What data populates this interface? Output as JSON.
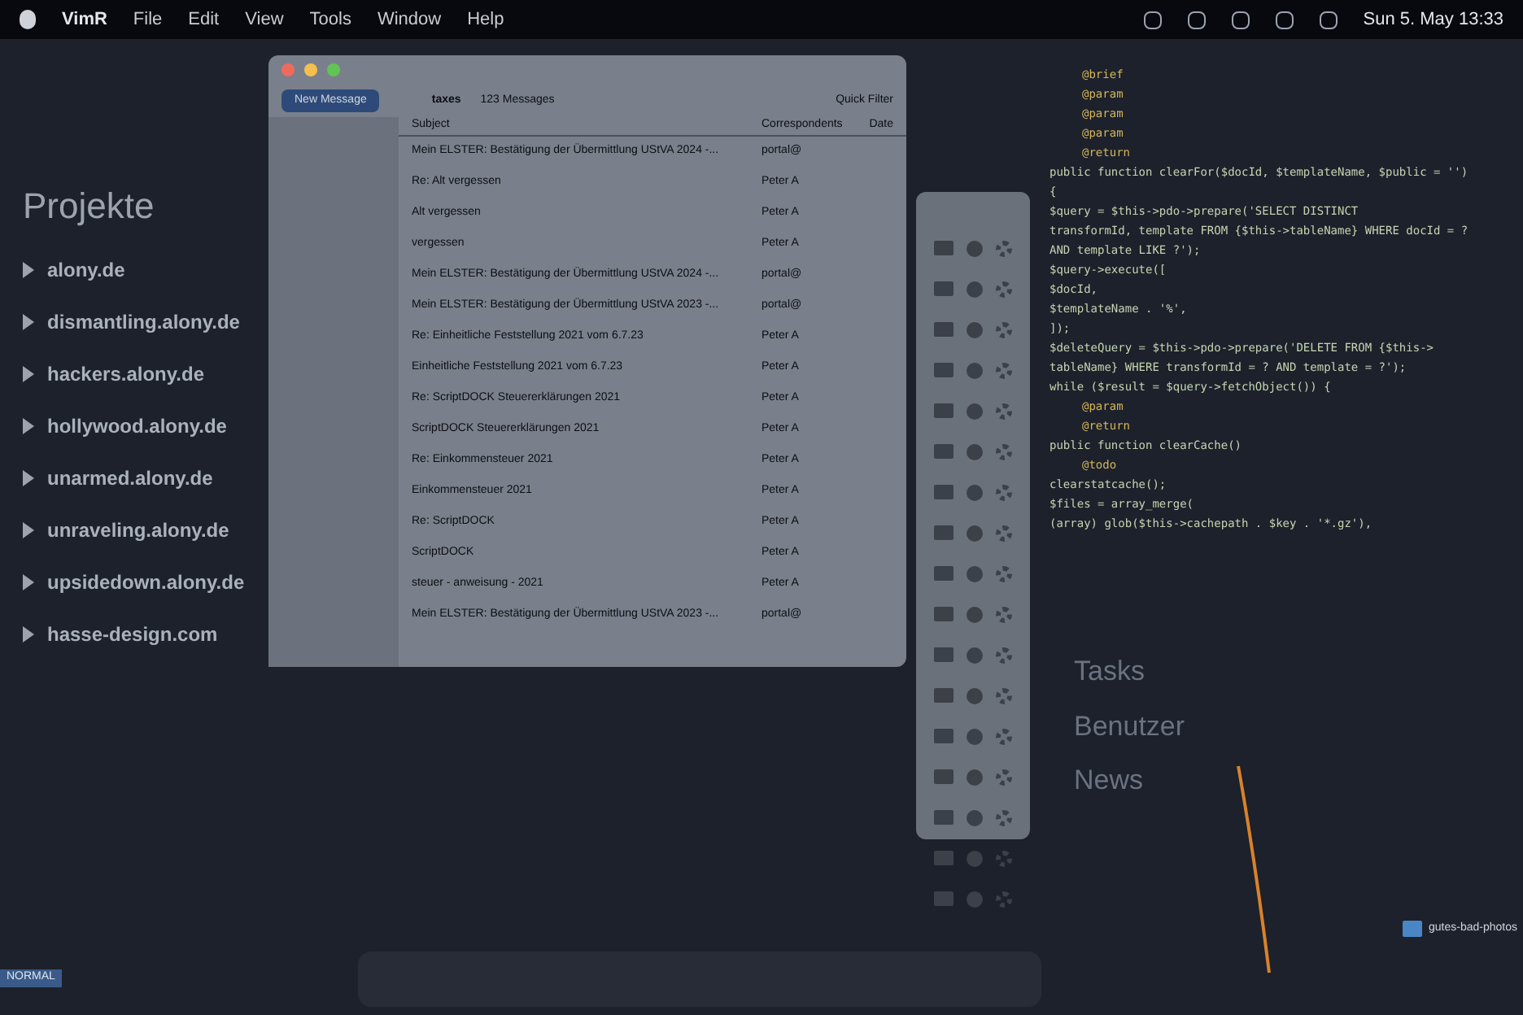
{
  "menu_bar": {
    "app": "VimR",
    "items": [
      "File",
      "Edit",
      "View",
      "Tools",
      "Window",
      "Help"
    ],
    "clock": "Sun 5. May 13:33"
  },
  "projects": {
    "title": "Projekte",
    "items": [
      "alony.de",
      "dismantling.alony.de",
      "hackers.alony.de",
      "hollywood.alony.de",
      "unarmed.alony.de",
      "unraveling.alony.de",
      "upsidedown.alony.de",
      "hasse-design.com"
    ]
  },
  "mail": {
    "new_message": "New Message",
    "folder": "taxes",
    "count": "123 Messages",
    "quick_filter": "Quick Filter",
    "columns": [
      "Subject",
      "Correspondents",
      "Date"
    ],
    "rows": [
      {
        "subject": "Mein ELSTER: Bestätigung der Übermittlung UStVA 2024 -...",
        "correspondent": "portal@"
      },
      {
        "subject": "Re: Alt vergessen",
        "correspondent": "Peter A"
      },
      {
        "subject": "Alt vergessen",
        "correspondent": "Peter A"
      },
      {
        "subject": "vergessen",
        "correspondent": "Peter A"
      },
      {
        "subject": "Mein ELSTER: Bestätigung der Übermittlung UStVA 2024 -...",
        "correspondent": "portal@"
      },
      {
        "subject": "Mein ELSTER: Bestätigung der Übermittlung UStVA 2023 -...",
        "correspondent": "portal@"
      },
      {
        "subject": "Re: Einheitliche Feststellung 2021 vom 6.7.23",
        "correspondent": "Peter A"
      },
      {
        "subject": "Einheitliche Feststellung 2021 vom 6.7.23",
        "correspondent": "Peter A"
      },
      {
        "subject": "Re: ScriptDOCK Steuererklärungen 2021",
        "correspondent": "Peter A"
      },
      {
        "subject": "ScriptDOCK Steuererklärungen 2021",
        "correspondent": "Peter A"
      },
      {
        "subject": "Re: Einkommensteuer 2021",
        "correspondent": "Peter A"
      },
      {
        "subject": "Einkommensteuer 2021",
        "correspondent": "Peter A"
      },
      {
        "subject": "Re: ScriptDOCK",
        "correspondent": "Peter A"
      },
      {
        "subject": "ScriptDOCK",
        "correspondent": "Peter A"
      },
      {
        "subject": "steuer - anweisung - 2021",
        "correspondent": "Peter A"
      },
      {
        "subject": "Mein ELSTER: Bestätigung der Übermittlung UStVA 2023 -...",
        "correspondent": "portal@"
      }
    ]
  },
  "code": {
    "lines": [
      {
        "kind": "comment",
        "text": "@brief"
      },
      {
        "kind": "comment",
        "text": "@param"
      },
      {
        "kind": "comment",
        "text": "@param"
      },
      {
        "kind": "comment",
        "text": "@param"
      },
      {
        "kind": "comment",
        "text": "@return"
      },
      {
        "kind": "code",
        "text": "public function clearFor($docId, $templateName, $public = '')"
      },
      {
        "kind": "code",
        "text": "{"
      },
      {
        "kind": "code",
        "text": "$query = $this->pdo->prepare('SELECT DISTINCT"
      },
      {
        "kind": "code",
        "text": "transformId, template FROM {$this->tableName} WHERE docId = ?"
      },
      {
        "kind": "code",
        "text": "AND template LIKE ?');"
      },
      {
        "kind": "code",
        "text": "$query->execute(["
      },
      {
        "kind": "code",
        "text": "$docId,"
      },
      {
        "kind": "code",
        "text": "$templateName . '%',"
      },
      {
        "kind": "code",
        "text": "]);"
      },
      {
        "kind": "code",
        "text": "$deleteQuery = $this->pdo->prepare('DELETE FROM {$this->"
      },
      {
        "kind": "code",
        "text": "tableName} WHERE transformId = ? AND template = ?');"
      },
      {
        "kind": "code",
        "text": "while ($result = $query->fetchObject()) {"
      },
      {
        "kind": "comment",
        "text": "@param"
      },
      {
        "kind": "comment",
        "text": "@return"
      },
      {
        "kind": "code",
        "text": "public function clearCache()"
      },
      {
        "kind": "comment",
        "text": "@todo"
      },
      {
        "kind": "code",
        "text": "clearstatcache();"
      },
      {
        "kind": "code",
        "text": "$files = array_merge("
      },
      {
        "kind": "code",
        "text": "(array) glob($this->cachepath . $key . '*.gz'),"
      }
    ]
  },
  "side_nav": [
    "Tasks",
    "Benutzer",
    "News"
  ],
  "desktop": {
    "folder": "gutes-bad-photos"
  },
  "status": {
    "mode": "NORMAL"
  }
}
